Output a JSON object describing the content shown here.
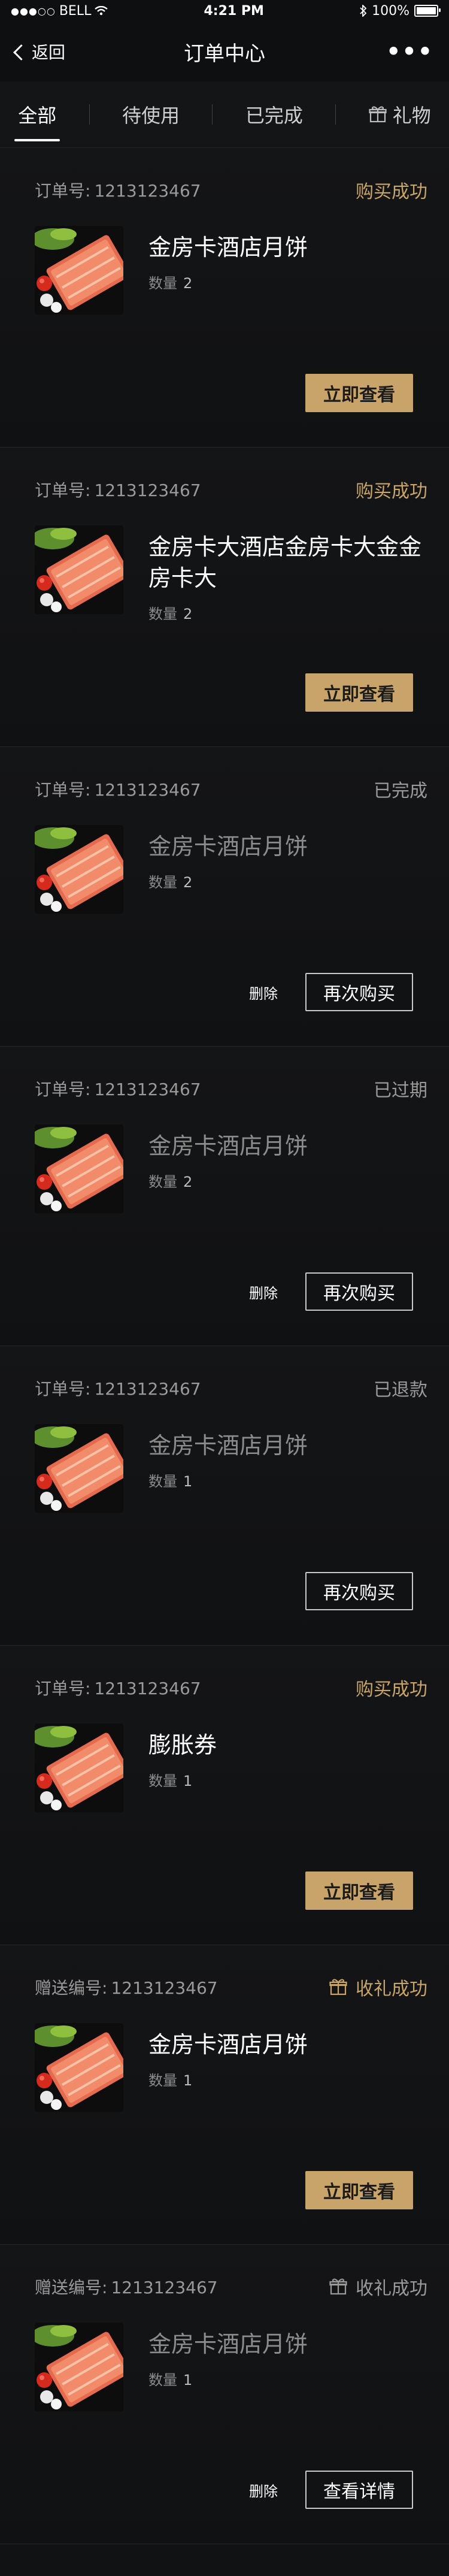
{
  "status_bar": {
    "carrier": "BELL",
    "time": "4:21 PM",
    "battery": "100%",
    "battery_level": 1.0
  },
  "nav": {
    "back_label": "返回",
    "title": "订单中心",
    "more": "•••"
  },
  "tabs": [
    {
      "label": "全部",
      "active": true
    },
    {
      "label": "待使用",
      "active": false
    },
    {
      "label": "已完成",
      "active": false
    },
    {
      "label": "礼物",
      "active": false
    }
  ],
  "orders": [
    {
      "no_label": "订单号:",
      "no": "1213123467",
      "status": "购买成功",
      "status_tone": "gold",
      "gift_icon": false,
      "name": "金房卡酒店月饼",
      "name_dim": false,
      "qty_label": "数量",
      "qty": "2",
      "delete_label": "",
      "button_label": "立即查看",
      "button_style": "gold"
    },
    {
      "no_label": "订单号:",
      "no": "1213123467",
      "status": "购买成功",
      "status_tone": "gold",
      "gift_icon": false,
      "name": "金房卡大酒店金房卡大金金房卡大",
      "name_dim": false,
      "qty_label": "数量",
      "qty": "2",
      "delete_label": "",
      "button_label": "立即查看",
      "button_style": "gold"
    },
    {
      "no_label": "订单号:",
      "no": "1213123467",
      "status": "已完成",
      "status_tone": "gray",
      "gift_icon": false,
      "name": "金房卡酒店月饼",
      "name_dim": true,
      "qty_label": "数量",
      "qty": "2",
      "delete_label": "删除",
      "button_label": "再次购买",
      "button_style": "outline"
    },
    {
      "no_label": "订单号:",
      "no": "1213123467",
      "status": "已过期",
      "status_tone": "gray",
      "gift_icon": false,
      "name": "金房卡酒店月饼",
      "name_dim": true,
      "qty_label": "数量",
      "qty": "2",
      "delete_label": "删除",
      "button_label": "再次购买",
      "button_style": "outline"
    },
    {
      "no_label": "订单号:",
      "no": "1213123467",
      "status": "已退款",
      "status_tone": "gray",
      "gift_icon": false,
      "name": "金房卡酒店月饼",
      "name_dim": true,
      "qty_label": "数量",
      "qty": "1",
      "delete_label": "",
      "button_label": "再次购买",
      "button_style": "outline"
    },
    {
      "no_label": "订单号:",
      "no": "1213123467",
      "status": "购买成功",
      "status_tone": "gold",
      "gift_icon": false,
      "name": "膨胀券",
      "name_dim": false,
      "qty_label": "数量",
      "qty": "1",
      "delete_label": "",
      "button_label": "立即查看",
      "button_style": "gold"
    },
    {
      "no_label": "赠送编号:",
      "no": "1213123467",
      "status": "收礼成功",
      "status_tone": "gold",
      "gift_icon": true,
      "name": "金房卡酒店月饼",
      "name_dim": false,
      "qty_label": "数量",
      "qty": "1",
      "delete_label": "",
      "button_label": "立即查看",
      "button_style": "gold"
    },
    {
      "no_label": "赠送编号:",
      "no": "1213123467",
      "status": "收礼成功",
      "status_tone": "gray",
      "gift_icon": true,
      "name": "金房卡酒店月饼",
      "name_dim": true,
      "qty_label": "数量",
      "qty": "1",
      "delete_label": "删除",
      "button_label": "查看详情",
      "button_style": "outline"
    }
  ],
  "colors": {
    "gold": "#c9a46a",
    "background": "#111214"
  }
}
